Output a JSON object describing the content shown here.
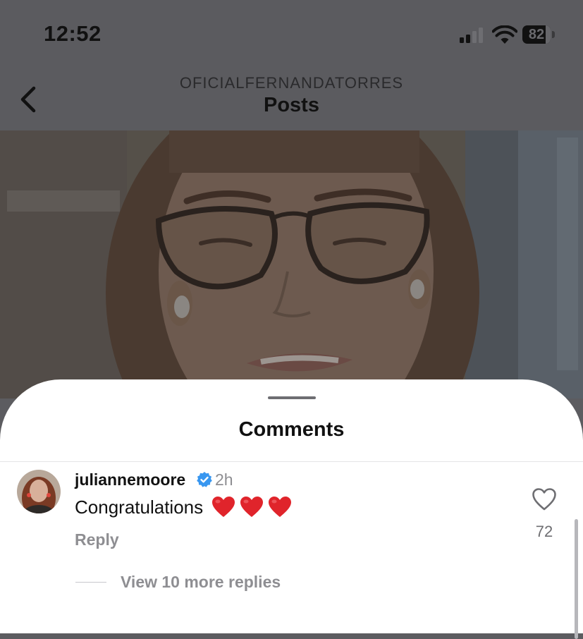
{
  "status_bar": {
    "time": "12:52",
    "battery_level": "82",
    "battery_fraction": 0.82,
    "icons": [
      "cellular-signal-icon",
      "wifi-icon",
      "battery-icon"
    ]
  },
  "header": {
    "account": "OFICIALFERNANDATORRES",
    "title": "Posts",
    "back_icon": "chevron-left-icon"
  },
  "comments_sheet": {
    "title": "Comments",
    "comment": {
      "username": "juliannemoore",
      "verified": true,
      "time": "2h",
      "text": "Congratulations",
      "emojis": [
        "red-heart",
        "red-heart",
        "red-heart"
      ],
      "reply_label": "Reply",
      "like_count": "72",
      "view_replies_label": "View 10 more replies"
    }
  },
  "colors": {
    "overlay_gray": "#5b5b5f",
    "verified_blue": "#3897f0",
    "heart_red": "#e0242b",
    "muted_text": "#8e8e92"
  }
}
